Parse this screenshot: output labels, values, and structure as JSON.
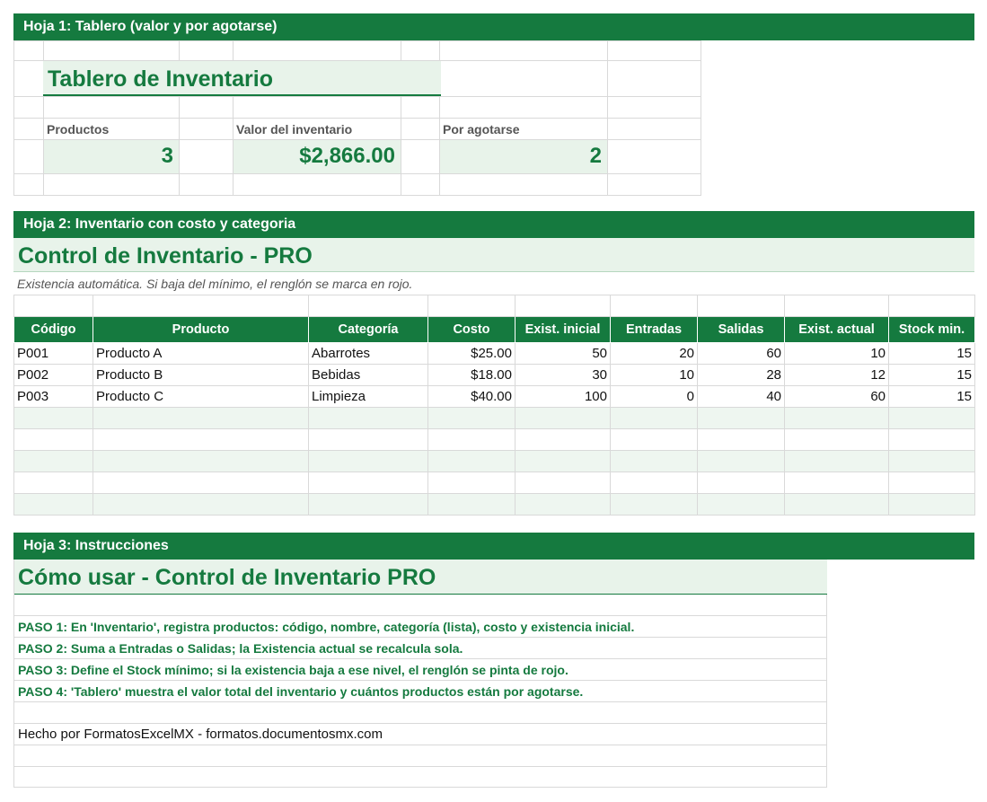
{
  "sheet1": {
    "bar_title": "Hoja 1: Tablero (valor y por agotarse)",
    "title": "Tablero de Inventario",
    "kpis": [
      {
        "label": "Productos",
        "value": "3"
      },
      {
        "label": "Valor del inventario",
        "value": "$2,866.00"
      },
      {
        "label": "Por agotarse",
        "value": "2"
      }
    ]
  },
  "sheet2": {
    "bar_title": "Hoja 2: Inventario con costo y categoria",
    "title": "Control de Inventario - PRO",
    "subtitle": "Existencia automática. Si baja del mínimo, el renglón se marca en rojo.",
    "headers": [
      "Código",
      "Producto",
      "Categoría",
      "Costo",
      "Exist. inicial",
      "Entradas",
      "Salidas",
      "Exist. actual",
      "Stock min."
    ],
    "rows": [
      [
        "P001",
        "Producto A",
        "Abarrotes",
        "$25.00",
        "50",
        "20",
        "60",
        "10",
        "15"
      ],
      [
        "P002",
        "Producto B",
        "Bebidas",
        "$18.00",
        "30",
        "10",
        "28",
        "12",
        "15"
      ],
      [
        "P003",
        "Producto C",
        "Limpieza",
        "$40.00",
        "100",
        "0",
        "40",
        "60",
        "15"
      ]
    ]
  },
  "sheet3": {
    "bar_title": "Hoja 3: Instrucciones",
    "title": "Cómo usar - Control de Inventario PRO",
    "steps": [
      "PASO 1: En 'Inventario', registra productos: código, nombre, categoría (lista), costo y existencia inicial.",
      "PASO 2: Suma a Entradas o Salidas; la Existencia actual se recalcula sola.",
      "PASO 3: Define el Stock mínimo; si la existencia baja a ese nivel, el renglón se pinta de rojo.",
      "PASO 4: 'Tablero' muestra el valor total del inventario y cuántos productos están por agotarse."
    ],
    "footer": "Hecho por FormatosExcelMX - formatos.documentosmx.com"
  },
  "colors": {
    "accent": "#157a3f",
    "band": "#e8f3ea",
    "grid": "#d9d9d9"
  }
}
